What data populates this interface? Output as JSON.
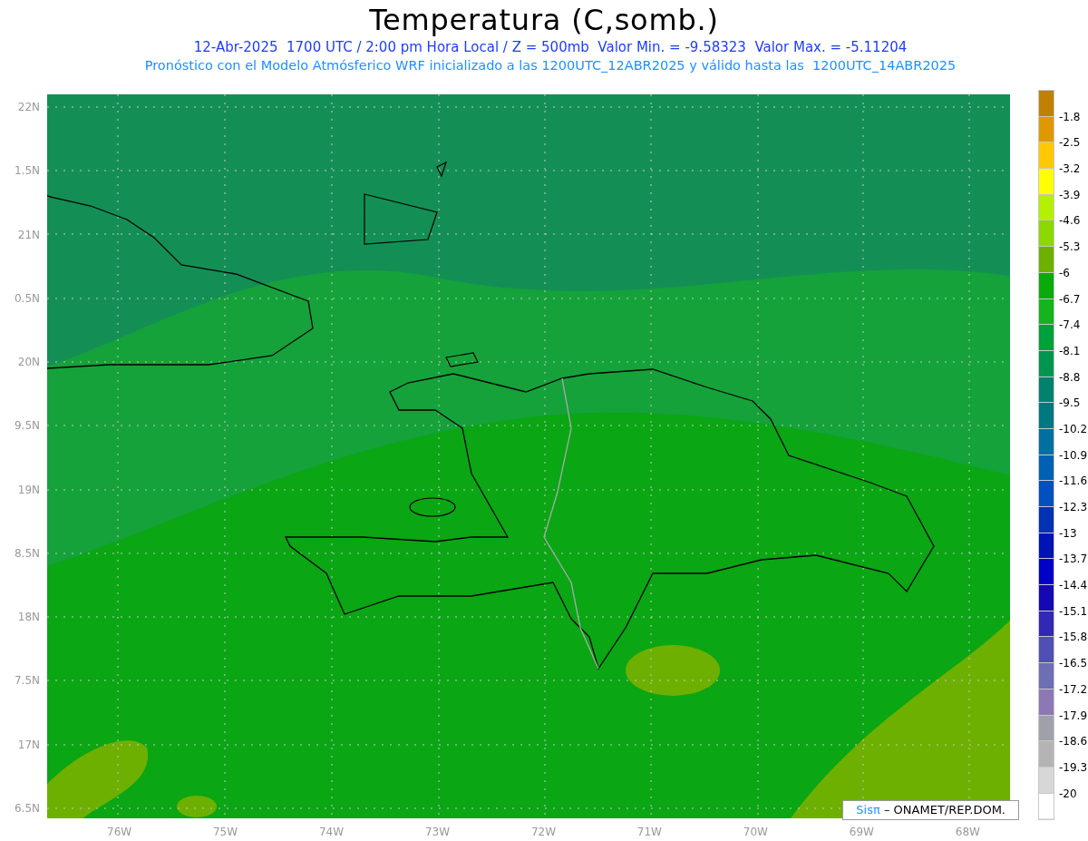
{
  "title": "Temperatura (C,somb.)",
  "subtitle": "12-Abr-2025  1700 UTC / 2:00 pm Hora Local / Z = 500mb  Valor Min. = -9.58323  Valor Max. = -5.11204",
  "forecast_line": "Pronóstico con el Modelo Atmósferico WRF inicializado a las 1200UTC_12ABR2025 y válido hasta las  1200UTC_14ABR2025",
  "map": {
    "y_labels": [
      "22N",
      "1.5N",
      "21N",
      "0.5N",
      "20N",
      "9.5N",
      "19N",
      "8.5N",
      "18N",
      "7.5N",
      "17N",
      "6.5N"
    ],
    "x_labels": [
      "76W",
      "75W",
      "74W",
      "73W",
      "72W",
      "71W",
      "70W",
      "69W",
      "68W"
    ],
    "credit": {
      "brand": "Sisπ",
      "text": "– ONAMET/REP.DOM."
    }
  },
  "colorbar": [
    {
      "color": "#c08000",
      "label": "-1.8"
    },
    {
      "color": "#e09800",
      "label": "-2.5"
    },
    {
      "color": "#ffc800",
      "label": "-3.2"
    },
    {
      "color": "#ffff00",
      "label": "-3.9"
    },
    {
      "color": "#b4f000",
      "label": "-4.6"
    },
    {
      "color": "#8cd800",
      "label": "-5.3"
    },
    {
      "color": "#6eb000",
      "label": "-6"
    },
    {
      "color": "#0aaa0a",
      "label": "-6.7"
    },
    {
      "color": "#14b41e",
      "label": "-7.4"
    },
    {
      "color": "#00a03c",
      "label": "-8.1"
    },
    {
      "color": "#009650",
      "label": "-8.8"
    },
    {
      "color": "#00826e",
      "label": "-9.5"
    },
    {
      "color": "#007882",
      "label": "-10.2"
    },
    {
      "color": "#0070a0",
      "label": "-10.9"
    },
    {
      "color": "#0060b4",
      "label": "-11.6"
    },
    {
      "color": "#0050c0",
      "label": "-12.3"
    },
    {
      "color": "#0032b4",
      "label": "-13"
    },
    {
      "color": "#0014b4",
      "label": "-13.7"
    },
    {
      "color": "#0000c8",
      "label": "-14.4"
    },
    {
      "color": "#1408b4",
      "label": "-15.1"
    },
    {
      "color": "#3228b4",
      "label": "-15.8"
    },
    {
      "color": "#5050b4",
      "label": "-16.5"
    },
    {
      "color": "#6e6eb4",
      "label": "-17.2"
    },
    {
      "color": "#8c78b4",
      "label": "-17.9"
    },
    {
      "color": "#a0a0aa",
      "label": "-18.6"
    },
    {
      "color": "#b4b4b4",
      "label": "-19.3"
    },
    {
      "color": "#d7d7d7",
      "label": "-20"
    },
    {
      "color": "#ffffff"
    }
  ]
}
